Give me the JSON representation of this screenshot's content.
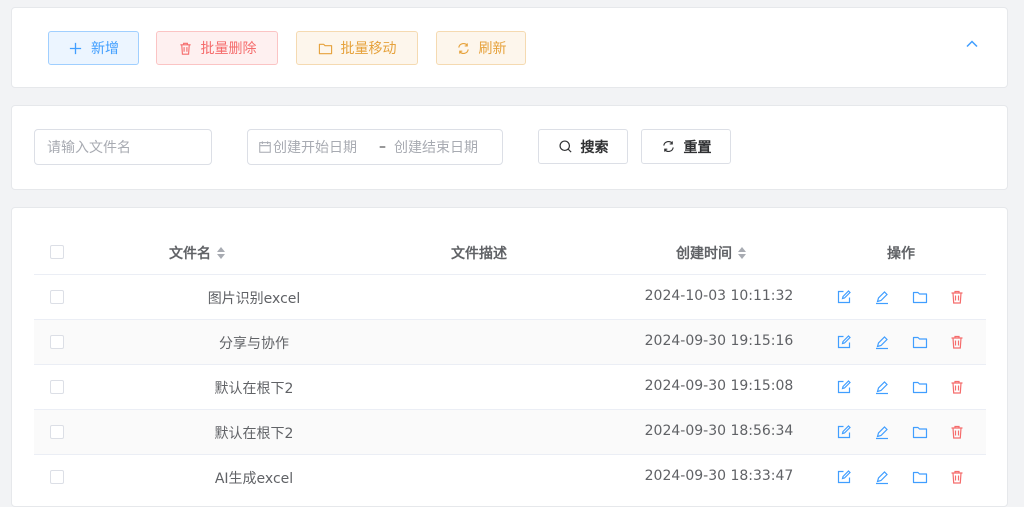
{
  "toolbar": {
    "add": "新增",
    "batch_delete": "批量删除",
    "batch_move": "批量移动",
    "refresh": "刷新"
  },
  "search": {
    "filename_placeholder": "请输入文件名",
    "start_date_placeholder": "创建开始日期",
    "date_separator": "–",
    "end_date_placeholder": "创建结束日期",
    "search_label": "搜索",
    "reset_label": "重置"
  },
  "table": {
    "headers": {
      "name": "文件名",
      "description": "文件描述",
      "created": "创建时间",
      "actions": "操作"
    },
    "rows": [
      {
        "name": "图片识别excel",
        "description": "",
        "created": "2024-10-03 10:11:32"
      },
      {
        "name": "分享与协作",
        "description": "",
        "created": "2024-09-30 19:15:16"
      },
      {
        "name": "默认在根下2",
        "description": "",
        "created": "2024-09-30 19:15:08"
      },
      {
        "name": "默认在根下2",
        "description": "",
        "created": "2024-09-30 18:56:34"
      },
      {
        "name": "AI生成excel",
        "description": "",
        "created": "2024-09-30 18:33:47"
      }
    ]
  },
  "icons": {
    "add": "plus-icon",
    "batch_delete": "trash-icon",
    "batch_move": "folder-icon",
    "refresh": "refresh-icon",
    "collapse": "chevron-up-icon",
    "search": "search-icon",
    "reset": "refresh-icon",
    "calendar": "calendar-icon",
    "row_edit": "edit-icon",
    "row_rename": "pen-icon",
    "row_move": "folder-icon",
    "row_delete": "trash-icon"
  },
  "colors": {
    "primary": "#409eff",
    "danger": "#f56c6c",
    "warning": "#e6a23c"
  }
}
